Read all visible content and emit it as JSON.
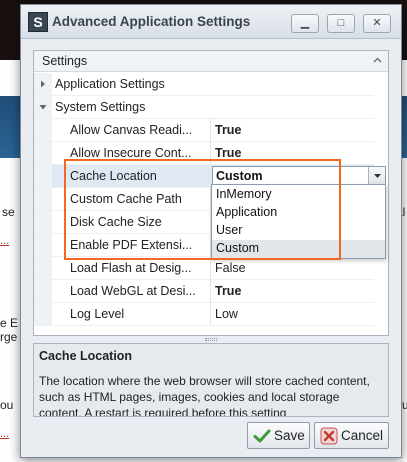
{
  "dialog": {
    "title": "Advanced Application Settings",
    "app_icon_glyph": "S",
    "window_buttons": [
      {
        "name": "minimize-button",
        "glyph": "▁"
      },
      {
        "name": "maximize-button",
        "glyph": "□"
      },
      {
        "name": "close-button",
        "glyph": "✕"
      }
    ]
  },
  "grid": {
    "header": "Settings",
    "rows": [
      {
        "name": "Application Settings",
        "value": "",
        "type": "category",
        "expanded": false
      },
      {
        "name": "System Settings",
        "value": "",
        "type": "category",
        "expanded": true
      },
      {
        "name": "Allow Canvas Readi...",
        "value": "True",
        "bold": true
      },
      {
        "name": "Allow Insecure Cont...",
        "value": "True",
        "bold": true
      },
      {
        "name": "Cache Location",
        "value": "Custom",
        "bold": true,
        "selected": true,
        "editor": "combo"
      },
      {
        "name": "Custom Cache Path",
        "value": ""
      },
      {
        "name": "Disk Cache Size",
        "value": ""
      },
      {
        "name": "Enable PDF Extensi...",
        "value": ""
      },
      {
        "name": "Load Flash at Desig...",
        "value": "False",
        "bold": false
      },
      {
        "name": "Load WebGL at Desi...",
        "value": "True",
        "bold": true
      },
      {
        "name": "Log Level",
        "value": "Low",
        "bold": false
      }
    ],
    "dropdown_options": [
      "InMemory",
      "Application",
      "User",
      "Custom"
    ],
    "dropdown_selected": "Custom"
  },
  "description": {
    "title": "Cache Location",
    "body": "The location where the web browser will store cached content, such as HTML pages, images, cookies and local storage content. A restart is required before this setting"
  },
  "buttons": {
    "save": "Save",
    "cancel": "Cancel"
  },
  "background": {
    "left_text": [
      "se",
      "e E",
      "rge",
      "ou"
    ],
    "right_text": [
      "al",
      "su"
    ]
  },
  "colors": {
    "highlight": "#f26a21",
    "selected_row": "#dfe8f3"
  }
}
